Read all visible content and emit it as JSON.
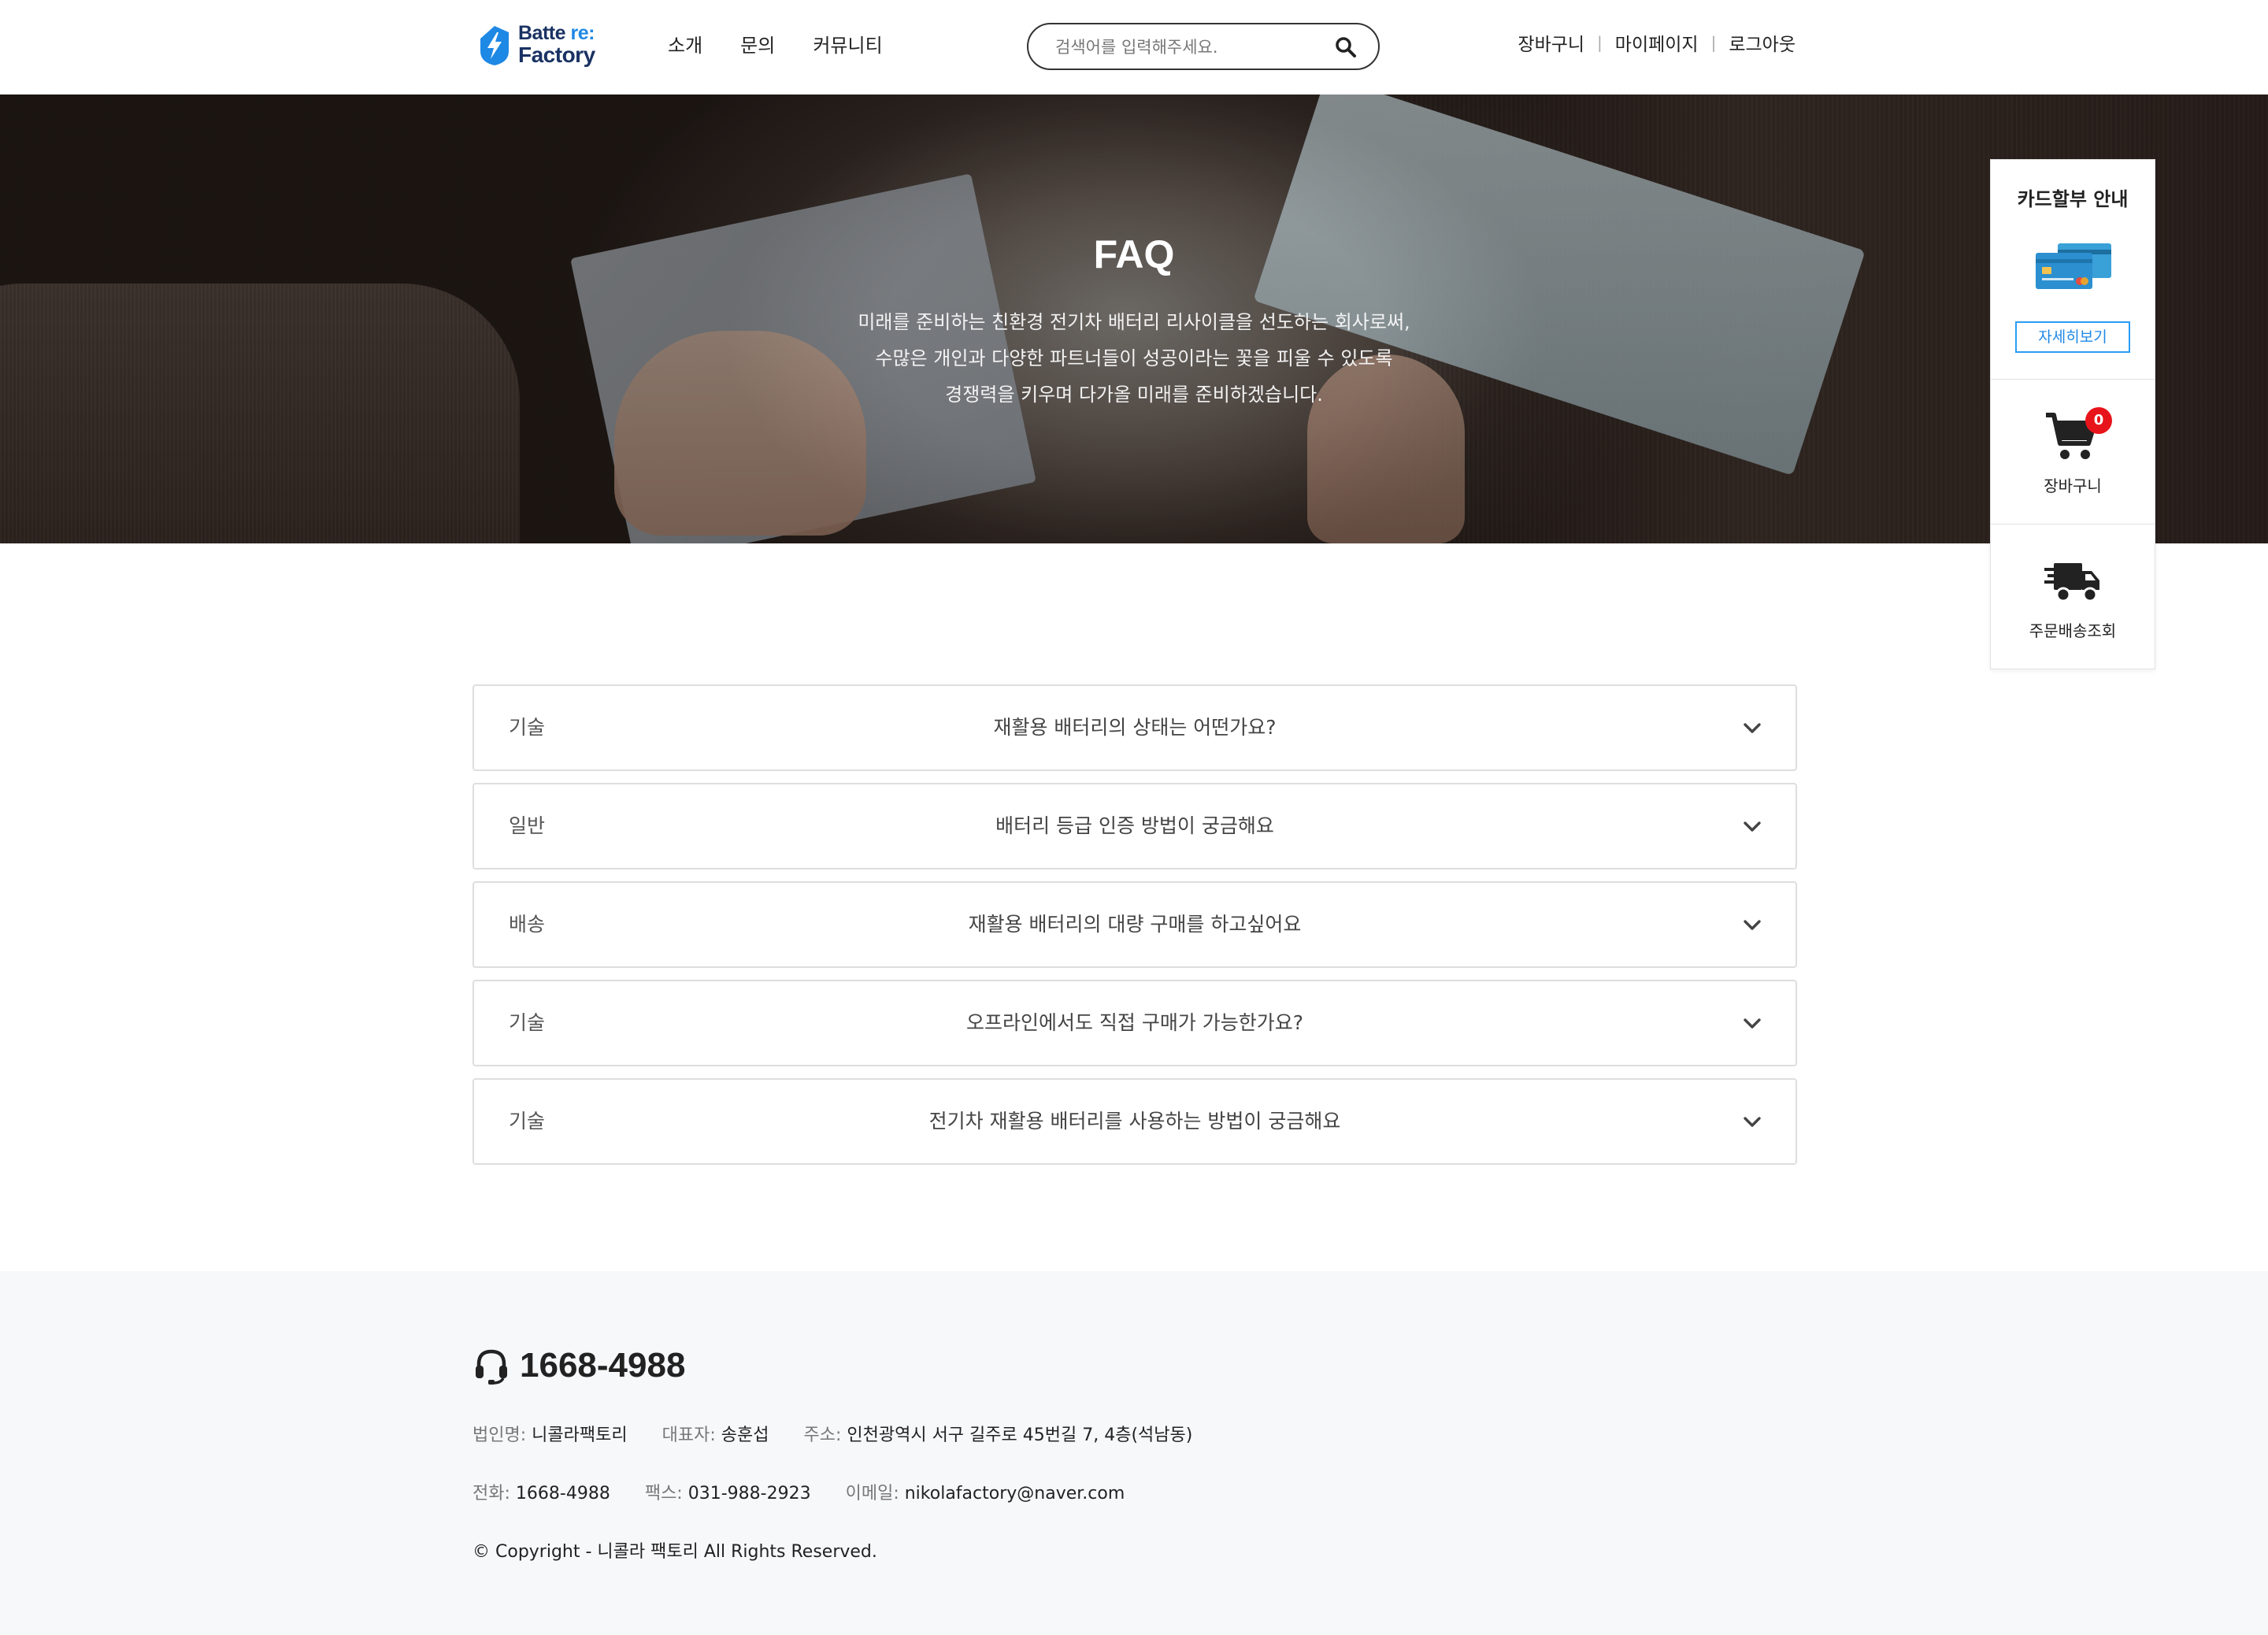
{
  "header": {
    "logo": {
      "line1": "Batte",
      "line1_accent": "re:",
      "line2": "Factory"
    },
    "nav": [
      "소개",
      "문의",
      "커뮤니티"
    ],
    "search": {
      "placeholder": "검색어를 입력해주세요."
    },
    "util": [
      "장바구니",
      "마이페이지",
      "로그아웃"
    ]
  },
  "hero": {
    "title": "FAQ",
    "desc": [
      "미래를 준비하는 친환경 전기차 배터리 리사이클을 선도하는 회사로써,",
      "수많은 개인과 다양한 파트너들이 성공이라는 꽃을 피울 수 있도록",
      "경쟁력을 키우며 다가올 미래를 준비하겠습니다."
    ]
  },
  "quick_menu": {
    "card_title": "카드할부 안내",
    "card_button": "자세히보기",
    "cart_label": "장바구니",
    "cart_count": "0",
    "ship_label": "주문배송조회"
  },
  "faq": [
    {
      "category": "기술",
      "question": "재활용 배터리의 상태는 어떤가요?"
    },
    {
      "category": "일반",
      "question": "배터리 등급 인증 방법이 궁금해요"
    },
    {
      "category": "배송",
      "question": "재활용 배터리의 대량 구매를 하고싶어요"
    },
    {
      "category": "기술",
      "question": "오프라인에서도 직접 구매가 가능한가요?"
    },
    {
      "category": "기술",
      "question": "전기차 재활용 배터리를 사용하는 방법이 궁금해요"
    }
  ],
  "footer": {
    "phone": "1668-4988",
    "company_label": "법인명:",
    "company": "니콜라팩토리",
    "ceo_label": "대표자:",
    "ceo": "송훈섭",
    "address_label": "주소:",
    "address": "인천광역시 서구 길주로 45번길 7, 4층(석남동)",
    "tel_label": "전화:",
    "tel": "1668-4988",
    "fax_label": "팩스:",
    "fax": "031-988-2923",
    "email_label": "이메일:",
    "email": "nikolafactory@naver.com",
    "copyright": "© Copyright - 니콜라 팩토리 All Rights Reserved."
  },
  "colors": {
    "accent": "#1e88e5",
    "badge": "#e8141b",
    "footer_bg": "#f7f8fa"
  },
  "icons": [
    "bolt-logo-icon",
    "search-icon",
    "credit-card-icon",
    "cart-icon",
    "truck-icon",
    "chevron-down-icon",
    "headset-icon"
  ]
}
